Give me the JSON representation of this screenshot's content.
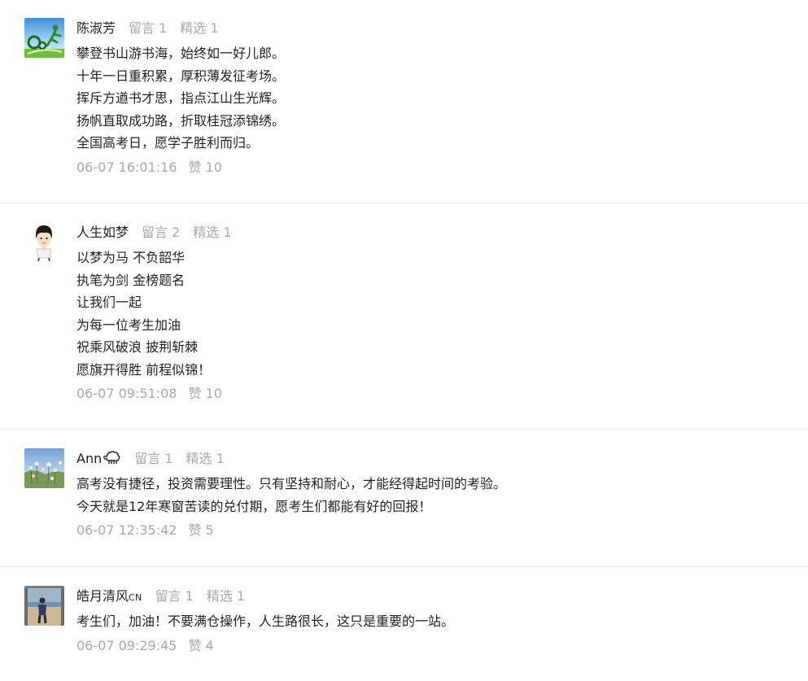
{
  "comments": [
    {
      "nickname": "陈淑芳",
      "messages": "留言 1",
      "featured": "精选 1",
      "lines": [
        "攀登书山游书海，始终如一好儿郎。",
        "十年一日重积累，厚积薄发征考场。",
        "挥斥方遒书才思，指点江山生光辉。",
        "扬帆直取成功路，折取桂冠添锦绣。",
        "全国高考日，愿学子胜利而归。"
      ],
      "time": "06-07 16:01:16",
      "likes": "赞 10"
    },
    {
      "nickname": "人生如梦",
      "messages": "留言 2",
      "featured": "精选 1",
      "lines": [
        "以梦为马 不负韶华",
        "执笔为剑 金榜题名",
        "让我们一起",
        "为每一位考生加油",
        "祝乘风破浪 披荆斩棘",
        "愿旗开得胜 前程似锦！"
      ],
      "time": "06-07 09:51:08",
      "likes": "赞 10"
    },
    {
      "nickname": "Ann",
      "messages": "留言 1",
      "featured": "精选 1",
      "lines": [
        "高考没有捷径，投资需要理性。只有坚持和耐心，才能经得起时间的考验。",
        "今天就是12年寒窗苦读的兑付期，愿考生们都能有好的回报！"
      ],
      "time": "06-07 12:35:42",
      "likes": "赞 5"
    },
    {
      "nickname": "皓月清风",
      "nickname_suffix": "CN",
      "messages": "留言 1",
      "featured": "精选 1",
      "lines": [
        "考生们，加油！不要满仓操作，人生路很长，这只是重要的一站。"
      ],
      "time": "06-07 09:29:45",
      "likes": "赞 4"
    }
  ]
}
